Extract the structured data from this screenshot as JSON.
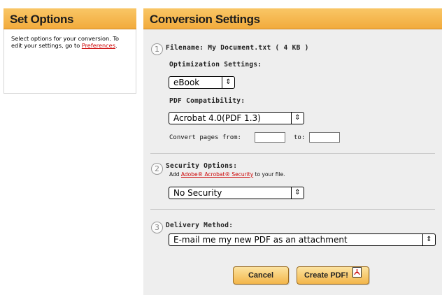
{
  "left": {
    "title": "Set Options",
    "desc": "Select options for your conversion. To edit your settings, go to ",
    "link": "Preferences",
    "period": "."
  },
  "right": {
    "title": "Conversion Settings",
    "steps": [
      {
        "num": "1",
        "label": "Filename: My Document.txt ( 4 KB )"
      },
      {
        "num": "2",
        "label": "Security Options:"
      },
      {
        "num": "3",
        "label": "Delivery Method:"
      }
    ],
    "optimization": {
      "label": "Optimization Settings:",
      "value": "eBook"
    },
    "compat": {
      "label": "PDF Compatibility:",
      "value": "Acrobat 4.0(PDF 1.3)"
    },
    "pages": {
      "from_label": "Convert pages from:",
      "to_label": "to:"
    },
    "security": {
      "add_prefix": "Add",
      "link": "Adobe® Acrobat® Security",
      "add_suffix": "to your file.",
      "value": "No Security"
    },
    "delivery": {
      "value": "E-mail me my new PDF as an attachment"
    },
    "buttons": {
      "cancel": "Cancel",
      "create": "Create PDF!"
    }
  },
  "icons": {
    "select_arrow": "up-down-arrows-icon",
    "pdf": "pdf-document-icon"
  }
}
